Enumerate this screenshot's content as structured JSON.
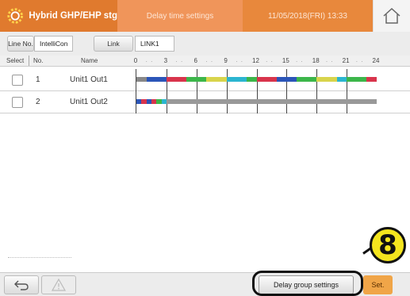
{
  "header": {
    "app_title": "Hybrid GHP/EHP stg",
    "screen_title": "Delay time settings",
    "datetime": "11/05/2018(FRI) 13:33",
    "colors": {
      "orange_dark": "#e07a2e",
      "orange": "#e8883c",
      "orange_light": "#f0955a"
    }
  },
  "filters": {
    "line_no_label": "Line No.",
    "line_no_value": "IntelliCon",
    "link_label": "Link",
    "link_value": "LINK1"
  },
  "columns": {
    "select": "Select",
    "no": "No.",
    "name": "Name",
    "ticks": [
      "0",
      "3",
      "6",
      "9",
      "12",
      "15",
      "18",
      "21",
      "24"
    ]
  },
  "rows": [
    {
      "no": "1",
      "name": "Unit1 Out1",
      "segments": [
        {
          "start": 0,
          "end": 1,
          "color": "#888888"
        },
        {
          "start": 1,
          "end": 3,
          "color": "#2b55b8"
        },
        {
          "start": 3,
          "end": 5,
          "color": "#d8344c"
        },
        {
          "start": 5,
          "end": 7,
          "color": "#3cb64a"
        },
        {
          "start": 7,
          "end": 9,
          "color": "#d8d44c"
        },
        {
          "start": 9,
          "end": 11,
          "color": "#2bb5d0"
        },
        {
          "start": 11,
          "end": 12,
          "color": "#3cb64a"
        },
        {
          "start": 12,
          "end": 14,
          "color": "#d8344c"
        },
        {
          "start": 14,
          "end": 16,
          "color": "#2b55b8"
        },
        {
          "start": 16,
          "end": 18,
          "color": "#3cb64a"
        },
        {
          "start": 18,
          "end": 20,
          "color": "#d8d44c"
        },
        {
          "start": 20,
          "end": 21,
          "color": "#2bb5d0"
        },
        {
          "start": 21,
          "end": 23,
          "color": "#3cb64a"
        },
        {
          "start": 23,
          "end": 24,
          "color": "#d8344c"
        }
      ]
    },
    {
      "no": "2",
      "name": "Unit1 Out2",
      "segments": [
        {
          "start": 0,
          "end": 0.5,
          "color": "#2b55b8"
        },
        {
          "start": 0.5,
          "end": 1,
          "color": "#d8344c"
        },
        {
          "start": 1,
          "end": 1.5,
          "color": "#2b55b8"
        },
        {
          "start": 1.5,
          "end": 2,
          "color": "#d8344c"
        },
        {
          "start": 2,
          "end": 2.5,
          "color": "#3cb64a"
        },
        {
          "start": 2.5,
          "end": 3,
          "color": "#2bb5d0"
        },
        {
          "start": 3,
          "end": 24,
          "color": "#999999"
        }
      ]
    }
  ],
  "footer": {
    "back_icon": "back-arrow-icon",
    "warning_icon": "warning-icon",
    "delay_group_label": "Delay group settings",
    "set_label": "Set."
  },
  "callout": {
    "number": "8"
  }
}
